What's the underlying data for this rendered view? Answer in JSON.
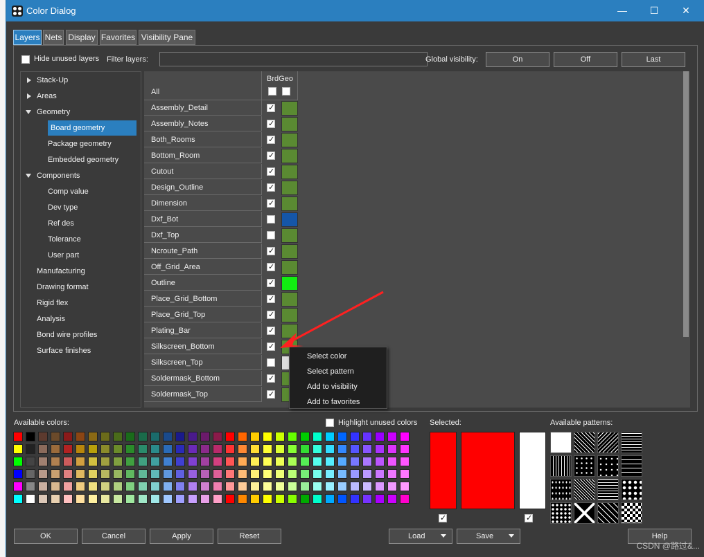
{
  "window": {
    "title": "Color Dialog",
    "minimize": "—",
    "maximize": "☐",
    "close": "✕"
  },
  "tabs": [
    "Layers",
    "Nets",
    "Display",
    "Favorites",
    "Visibility Pane"
  ],
  "topbar": {
    "hide_unused_label": "Hide unused layers",
    "filter_label": "Filter layers:",
    "filter_value": "",
    "global_visibility_label": "Global visibility:",
    "on_label": "On",
    "off_label": "Off",
    "last_label": "Last"
  },
  "tree": [
    {
      "label": "Stack-Up",
      "level": 0,
      "expander": "right"
    },
    {
      "label": "Areas",
      "level": 0,
      "expander": "right"
    },
    {
      "label": "Geometry",
      "level": 0,
      "expander": "down"
    },
    {
      "label": "Board geometry",
      "level": 1,
      "selected": true
    },
    {
      "label": "Package geometry",
      "level": 1
    },
    {
      "label": "Embedded geometry",
      "level": 1
    },
    {
      "label": "Components",
      "level": 0,
      "expander": "down"
    },
    {
      "label": "Comp value",
      "level": 1
    },
    {
      "label": "Dev type",
      "level": 1
    },
    {
      "label": "Ref des",
      "level": 1
    },
    {
      "label": "Tolerance",
      "level": 1
    },
    {
      "label": "User part",
      "level": 1
    },
    {
      "label": "Manufacturing",
      "level": 0
    },
    {
      "label": "Drawing format",
      "level": 0
    },
    {
      "label": "Rigid flex",
      "level": 0
    },
    {
      "label": "Analysis",
      "level": 0
    },
    {
      "label": "Bond wire profiles",
      "level": 0
    },
    {
      "label": "Surface finishes",
      "level": 0
    }
  ],
  "grid": {
    "column_header": "BrdGeo",
    "all_label": "All",
    "layers": [
      {
        "name": "Assembly_Detail",
        "checked": true,
        "color": "#5a8a32"
      },
      {
        "name": "Assembly_Notes",
        "checked": true,
        "color": "#5a8a32"
      },
      {
        "name": "Both_Rooms",
        "checked": true,
        "color": "#5a8a32"
      },
      {
        "name": "Bottom_Room",
        "checked": true,
        "color": "#5a8a32"
      },
      {
        "name": "Cutout",
        "checked": true,
        "color": "#5a8a32"
      },
      {
        "name": "Design_Outline",
        "checked": true,
        "color": "#5a8a32"
      },
      {
        "name": "Dimension",
        "checked": true,
        "color": "#5a8a32"
      },
      {
        "name": "Dxf_Bot",
        "checked": false,
        "color": "#1556a8"
      },
      {
        "name": "Dxf_Top",
        "checked": false,
        "color": "#5a8a32"
      },
      {
        "name": "Ncroute_Path",
        "checked": true,
        "color": "#5a8a32"
      },
      {
        "name": "Off_Grid_Area",
        "checked": true,
        "color": "#5a8a32"
      },
      {
        "name": "Outline",
        "checked": true,
        "color": "#11ee11"
      },
      {
        "name": "Place_Grid_Bottom",
        "checked": true,
        "color": "#5a8a32"
      },
      {
        "name": "Place_Grid_Top",
        "checked": true,
        "color": "#5a8a32"
      },
      {
        "name": "Plating_Bar",
        "checked": true,
        "color": "#5a8a32"
      },
      {
        "name": "Silkscreen_Bottom",
        "checked": true,
        "color": "#5a8a32"
      },
      {
        "name": "Silkscreen_Top",
        "checked": false,
        "color": "#dcdcdc"
      },
      {
        "name": "Soldermask_Bottom",
        "checked": true,
        "color": "#5a8a32"
      },
      {
        "name": "Soldermask_Top",
        "checked": true,
        "color": "#5a8a32"
      }
    ]
  },
  "context_menu": [
    "Select color",
    "Select pattern",
    "Add to visibility",
    "Add to favorites"
  ],
  "available_colors_label": "Available colors:",
  "highlight_unused_label": "Highlight unused colors",
  "selected_label": "Selected:",
  "available_patterns_label": "Available patterns:",
  "palette": [
    [
      "#ff0000",
      "#000000",
      "#5c3a2e",
      "#6b4a2a",
      "#8b1a1a",
      "#8b4513",
      "#8b6914",
      "#6b6b1a",
      "#4a6b1a",
      "#1a6b1a",
      "#1a6b4a",
      "#1a6b6b",
      "#1a4a8b",
      "#1a1a8b",
      "#4a1a8b",
      "#6b1a6b",
      "#8b1a4a",
      "#ff0000",
      "#ff6600",
      "#ffcc00",
      "#ffff00",
      "#ccff00",
      "#66ff00",
      "#00cc00",
      "#00ffcc",
      "#00ccff",
      "#0066ff",
      "#3333ff",
      "#6633ff",
      "#9900ff",
      "#cc00ff",
      "#ff00ff"
    ],
    [
      "#ffff00",
      "#222222",
      "#8b6b5b",
      "#9b6b3b",
      "#b22222",
      "#b8860b",
      "#b8a00b",
      "#8b8b2a",
      "#6b8b2a",
      "#2a8b2a",
      "#2a8b6b",
      "#2a8b8b",
      "#2a6bb8",
      "#2a2ab8",
      "#6b2ab8",
      "#8b2a8b",
      "#b82a6b",
      "#ff3333",
      "#ff8833",
      "#ffdd33",
      "#ffff33",
      "#ddff33",
      "#88ff33",
      "#33dd33",
      "#33ffdd",
      "#33ddff",
      "#3388ff",
      "#5555ff",
      "#8855ff",
      "#aa33ff",
      "#dd33ff",
      "#ff33ff"
    ],
    [
      "#00ff00",
      "#444444",
      "#a08070",
      "#b08050",
      "#cd5c5c",
      "#d2a040",
      "#d2c040",
      "#a0a040",
      "#80a040",
      "#40a040",
      "#40a080",
      "#40a0a0",
      "#4080d2",
      "#4040d2",
      "#8040d2",
      "#a040a0",
      "#d24080",
      "#ff5555",
      "#ffaa55",
      "#ffee55",
      "#ffff55",
      "#eeff55",
      "#aaff55",
      "#55ee55",
      "#55ffee",
      "#55eeff",
      "#55aaff",
      "#7777ff",
      "#aa77ff",
      "#bb55ff",
      "#ee55ff",
      "#ff55ff"
    ],
    [
      "#0000ff",
      "#666666",
      "#b89a8a",
      "#c8a070",
      "#e08080",
      "#e0b860",
      "#e0d060",
      "#b8b860",
      "#98b860",
      "#60b860",
      "#60b898",
      "#60b8b8",
      "#6098e0",
      "#6060e0",
      "#9860e0",
      "#b860b8",
      "#e06098",
      "#ff7777",
      "#ffbb77",
      "#ffee77",
      "#ffff77",
      "#eeff77",
      "#bbff77",
      "#77ee77",
      "#77ffee",
      "#77eeff",
      "#77bbff",
      "#9999ff",
      "#bb99ff",
      "#cc77ff",
      "#ee77ff",
      "#ff77ff"
    ],
    [
      "#ff00ff",
      "#888888",
      "#cbb0a0",
      "#d8b890",
      "#f0a0a0",
      "#f0cc80",
      "#f0e080",
      "#d0d080",
      "#b0d080",
      "#80d080",
      "#80d0b0",
      "#80d0d0",
      "#80b0f0",
      "#8080f0",
      "#b080f0",
      "#d080d0",
      "#f080b0",
      "#ff9999",
      "#ffcc99",
      "#fff099",
      "#ffff99",
      "#f0ff99",
      "#ccff99",
      "#99f099",
      "#99fff0",
      "#99f0ff",
      "#99ccff",
      "#bbbbff",
      "#ccbbff",
      "#dd99ff",
      "#f099ff",
      "#ff99ff"
    ],
    [
      "#00ffff",
      "#ffffff",
      "#dcc8b8",
      "#e8d0b0",
      "#ffc0c0",
      "#ffe0a0",
      "#fff0a0",
      "#e8e8a0",
      "#c8e8a0",
      "#a0e8a0",
      "#a0e8c8",
      "#a0e8e8",
      "#a0c8ff",
      "#a0a0ff",
      "#c8a0ff",
      "#e8a0e8",
      "#ffa0c8",
      "#ff0000",
      "#ff8800",
      "#ffcc00",
      "#ffff00",
      "#ccff00",
      "#88ff00",
      "#00aa00",
      "#00ffcc",
      "#00aaff",
      "#0055ff",
      "#3333ff",
      "#7733ff",
      "#aa00ff",
      "#cc00ff",
      "#ff00cc"
    ]
  ],
  "selected": {
    "color1": "#ff0000",
    "color2": "#ff0000",
    "color3": "#ffffff",
    "check1": true,
    "check2": true
  },
  "buttons": {
    "ok": "OK",
    "cancel": "Cancel",
    "apply": "Apply",
    "reset": "Reset",
    "load": "Load",
    "save": "Save",
    "help": "Help"
  },
  "watermark": "CSDN @路过&..."
}
